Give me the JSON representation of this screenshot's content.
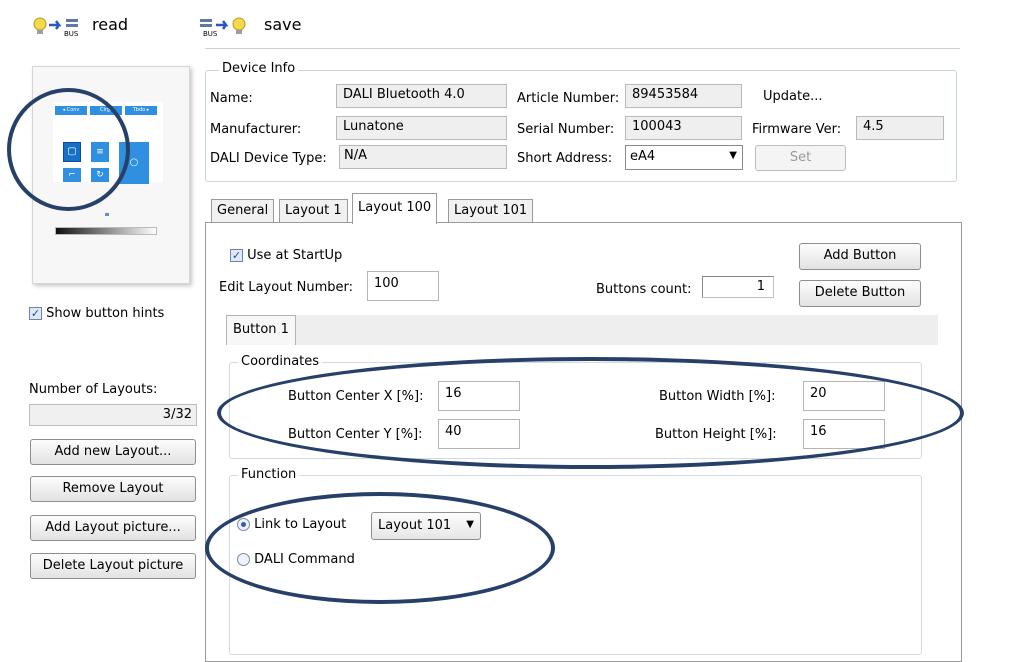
{
  "toolbar": {
    "read_label": "read",
    "save_label": "save",
    "bus_label": "BUS"
  },
  "preview": {
    "top_buttons": [
      "◂ Conv",
      "Clrgr",
      "Tbdo ▸"
    ],
    "show_hints_label": "Show button hints",
    "show_hints_checked": true
  },
  "layouts_panel": {
    "number_label": "Number of Layouts:",
    "count_value": "3/32",
    "add_new": "Add new Layout...",
    "remove": "Remove  Layout",
    "add_picture": "Add Layout picture...",
    "delete_picture": "Delete Layout picture"
  },
  "device_info": {
    "legend": "Device Info",
    "name_label": "Name:",
    "name_value": "DALI Bluetooth 4.0",
    "article_label": "Article Number:",
    "article_value": "89453584",
    "update_label": "Update...",
    "manufacturer_label": "Manufacturer:",
    "manufacturer_value": "Lunatone",
    "serial_label": "Serial Number:",
    "serial_value": "100043",
    "firmware_label": "Firmware Ver:",
    "firmware_value": "4.5",
    "type_label": "DALI Device Type:",
    "type_value": "N/A",
    "short_address_label": "Short Address:",
    "short_address_value": "eA4",
    "set_label": "Set"
  },
  "tabs": [
    "General",
    "Layout 1",
    "Layout 100",
    "Layout 101"
  ],
  "layout_tab": {
    "use_at_startup_label": "Use at StartUp",
    "use_at_startup_checked": true,
    "edit_layout_label": "Edit Layout Number:",
    "edit_layout_value": "100",
    "buttons_count_label": "Buttons count:",
    "buttons_count_value": "1",
    "add_button": "Add Button",
    "delete_button": "Delete Button",
    "button_tab": "Button 1"
  },
  "coordinates": {
    "legend": "Coordinates",
    "center_x_label": "Button Center X [%]:",
    "center_x_value": "16",
    "center_y_label": "Button Center Y [%]:",
    "center_y_value": "40",
    "width_label": "Button Width [%]:",
    "width_value": "20",
    "height_label": "Button Height [%]:",
    "height_value": "16"
  },
  "function": {
    "legend": "Function",
    "link_label": "Link to Layout",
    "link_selected": true,
    "link_target": "Layout 101",
    "dali_label": "DALI Command"
  },
  "colors": {
    "annotation_oval": "#27406a",
    "preview_tile": "#2f8fe0",
    "preview_tile_selected": "#1570c8"
  }
}
